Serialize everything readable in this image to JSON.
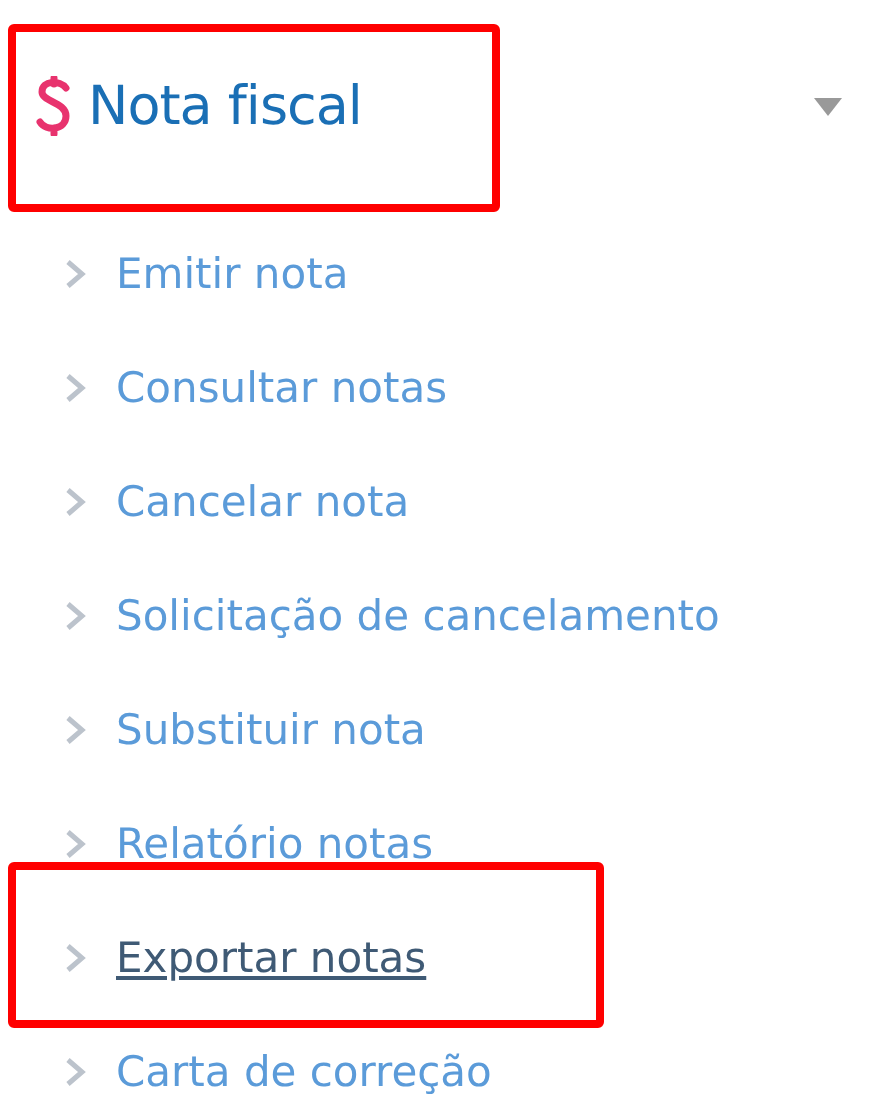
{
  "menu": {
    "title": "Nota fiscal",
    "expanded": true,
    "highlighted": true,
    "items": [
      {
        "label": "Emitir nota",
        "hovered": false,
        "highlighted": false
      },
      {
        "label": "Consultar notas",
        "hovered": false,
        "highlighted": false
      },
      {
        "label": "Cancelar nota",
        "hovered": false,
        "highlighted": false
      },
      {
        "label": "Solicitação de cancelamento",
        "hovered": false,
        "highlighted": false
      },
      {
        "label": "Substituir nota",
        "hovered": false,
        "highlighted": false
      },
      {
        "label": "Relatório notas",
        "hovered": false,
        "highlighted": false
      },
      {
        "label": "Exportar notas",
        "hovered": true,
        "highlighted": true
      },
      {
        "label": "Carta de correção",
        "hovered": false,
        "highlighted": false
      }
    ]
  }
}
